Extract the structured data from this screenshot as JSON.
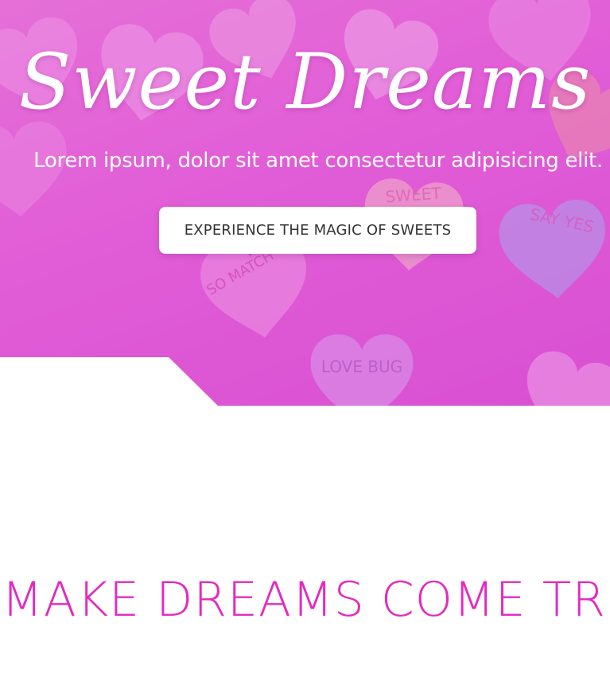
{
  "hero": {
    "title": "Sweet Dreams",
    "subtitle": "Lorem ipsum, dolor sit amet consectetur adipisicing elit.",
    "cta_label": "EXPERIENCE THE MAGIC OF SWEETS",
    "candy_texts": [
      "SWEET",
      "SAY YES",
      "SO MATCH",
      "LOVE BUG"
    ]
  },
  "section": {
    "heading": "MAKE DREAMS COME TRU"
  },
  "colors": {
    "hero_overlay": "#e260d8",
    "heading_accent": "#e22bbe",
    "button_bg": "#ffffff",
    "button_text": "#333333"
  }
}
